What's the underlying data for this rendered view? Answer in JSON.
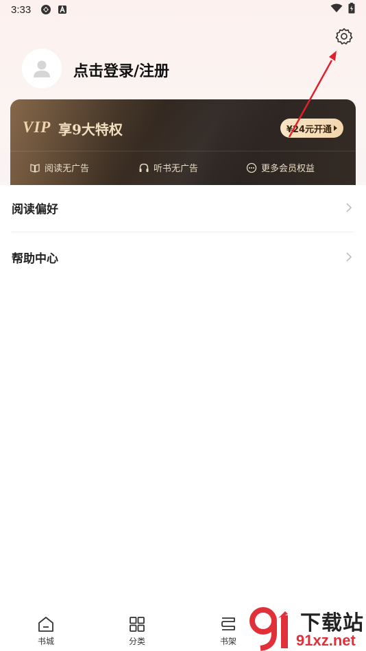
{
  "status_bar": {
    "time": "3:33",
    "icons": [
      "sync-icon",
      "a-icon",
      "wifi-icon",
      "battery-icon"
    ]
  },
  "profile": {
    "login_text": "点击登录/注册",
    "avatar_icon": "user-avatar-icon"
  },
  "settings": {
    "icon": "gear-icon"
  },
  "vip": {
    "logo": "VIP",
    "title": "享9大特权",
    "open_button": "¥24元开通",
    "benefits": [
      {
        "icon": "book-icon",
        "label": "阅读无广告"
      },
      {
        "icon": "headphones-icon",
        "label": "听书无广告"
      },
      {
        "icon": "more-icon",
        "label": "更多会员权益"
      }
    ]
  },
  "menu": [
    {
      "label": "阅读偏好"
    },
    {
      "label": "帮助中心"
    }
  ],
  "bottom_nav": [
    {
      "icon": "home-icon",
      "label": "书城"
    },
    {
      "icon": "category-icon",
      "label": "分类"
    },
    {
      "icon": "bookshelf-icon",
      "label": "书架"
    }
  ],
  "watermark": {
    "cn": "下载站",
    "en": "91xz.net"
  },
  "colors": {
    "accent_arrow": "#e0202a",
    "vip_gold": "#f3dfc0",
    "vip_dark": "#2a2320"
  }
}
